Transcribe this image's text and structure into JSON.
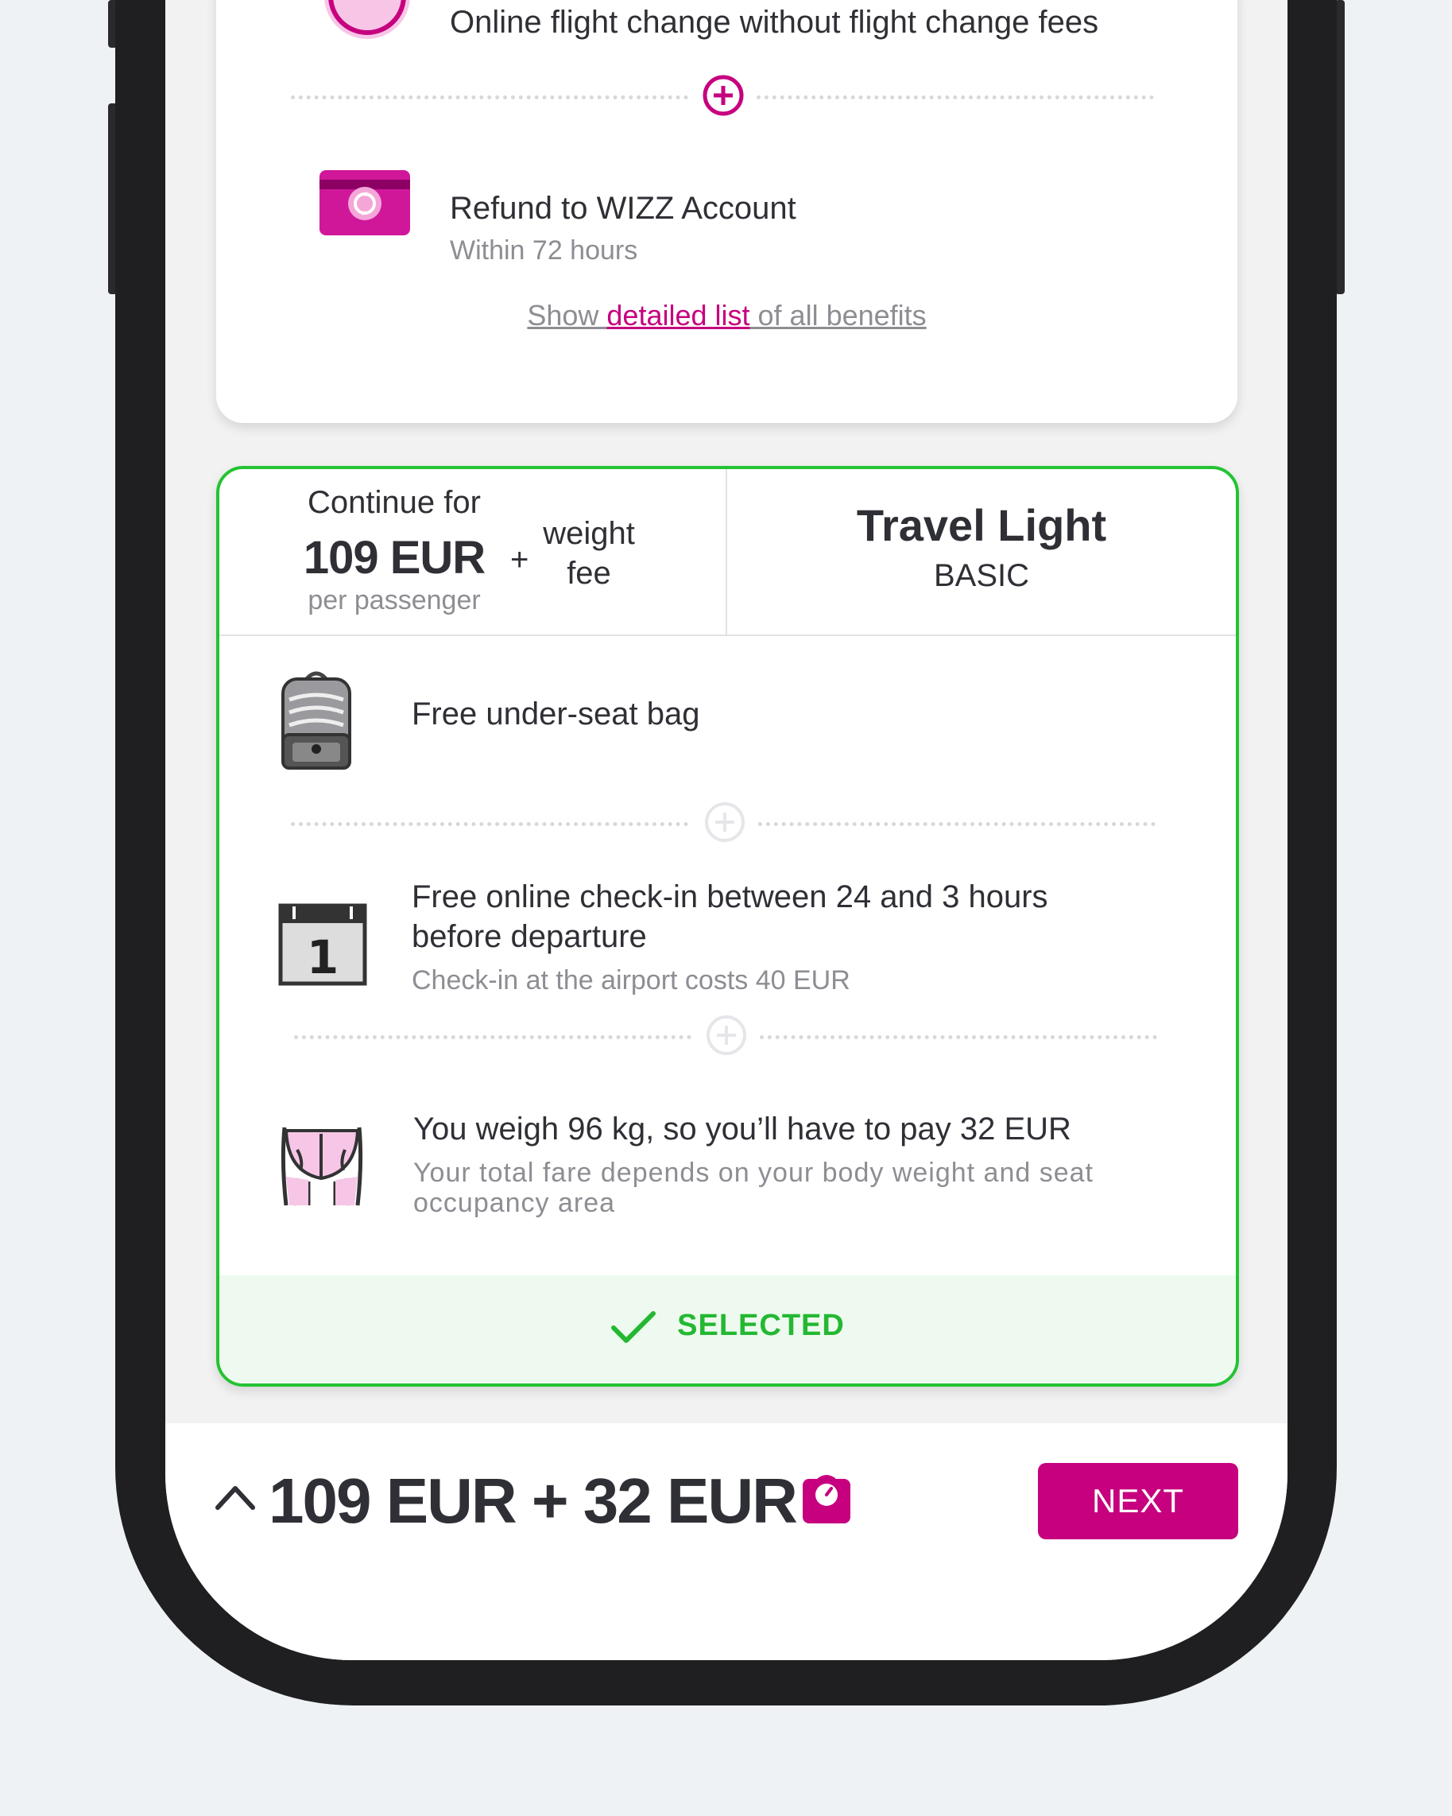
{
  "top_card": {
    "benefits": [
      {
        "title": "Online flight change without flight change fees",
        "icon": "plane-circle-icon"
      },
      {
        "title": "Refund to WIZZ Account",
        "subtitle": "Within 72 hours",
        "icon": "wallet-refund-icon"
      }
    ],
    "link": {
      "prefix": "Show ",
      "highlight": "detailed list",
      "suffix": " of all benefits"
    }
  },
  "fare_card": {
    "continue_label": "Continue for",
    "price": "109 EUR",
    "per_passenger": "per passenger",
    "plus": "+",
    "weight_fee_line1": "weight",
    "weight_fee_line2": "fee",
    "plan_name": "Travel Light",
    "plan_tier": "BASIC",
    "benefits": [
      {
        "title": "Free under-seat bag",
        "icon": "backpack-icon"
      },
      {
        "title_line1": "Free online check-in between 24 and 3 hours",
        "title_line2": "before departure",
        "subtitle": "Check-in at the airport costs 40 EUR",
        "icon": "calendar-icon"
      },
      {
        "title": "You weigh 96 kg, so you’ll have to pay 32 EUR",
        "subtitle_line1": "Your total fare depends on your body weight and seat",
        "subtitle_line2": "occupancy area",
        "icon": "buttocks-icon"
      }
    ],
    "selected_label": "SELECTED"
  },
  "footer": {
    "total": "109 EUR + 32 EUR",
    "next_label": "NEXT"
  },
  "colors": {
    "brand": "#c6007e",
    "selected_green": "#24c332",
    "text": "#2f2f36",
    "muted": "#8d8d93"
  }
}
